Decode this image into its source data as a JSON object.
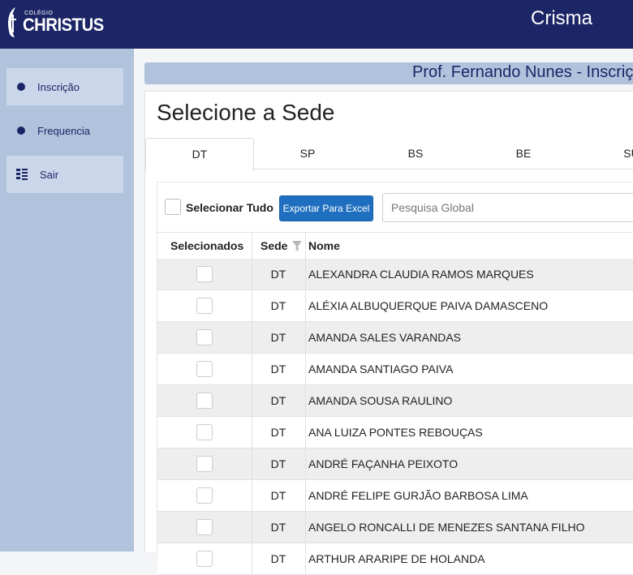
{
  "header": {
    "logo_small": "COLÉGIO",
    "logo_big": "CHRISTUS",
    "app_title": "Crisma"
  },
  "sidebar": {
    "items": [
      {
        "label": "Inscrição",
        "icon": "dot-icon"
      },
      {
        "label": "Frequencia",
        "icon": "dot-icon"
      },
      {
        "label": "Sair",
        "icon": "list-icon"
      }
    ]
  },
  "main": {
    "prof_banner": "Prof. Fernando Nunes - Inscriçã",
    "card_title": "Selecione a Sede",
    "tabs": [
      "DT",
      "SP",
      "BS",
      "BE",
      "SU"
    ],
    "active_tab": "DT",
    "select_all_label": "Selecionar Tudo",
    "export_button": "Exportar Para Excel",
    "search_placeholder": "Pesquisa Global",
    "columns": {
      "selected": "Selecionados",
      "sede": "Sede",
      "nome": "Nome"
    },
    "rows": [
      {
        "sede": "DT",
        "nome": "ALEXANDRA CLAUDIA RAMOS MARQUES"
      },
      {
        "sede": "DT",
        "nome": "ALÉXIA ALBUQUERQUE PAIVA DAMASCENO"
      },
      {
        "sede": "DT",
        "nome": "AMANDA SALES VARANDAS"
      },
      {
        "sede": "DT",
        "nome": "AMANDA SANTIAGO PAIVA"
      },
      {
        "sede": "DT",
        "nome": "AMANDA SOUSA RAULINO"
      },
      {
        "sede": "DT",
        "nome": "ANA LUIZA PONTES REBOUÇAS"
      },
      {
        "sede": "DT",
        "nome": "ANDRÉ FAÇANHA PEIXOTO"
      },
      {
        "sede": "DT",
        "nome": "ANDRÉ FELIPE GURJÃO BARBOSA LIMA"
      },
      {
        "sede": "DT",
        "nome": "ANGELO RONCALLI DE MENEZES SANTANA FILHO"
      },
      {
        "sede": "DT",
        "nome": "ARTHUR ARARIPE DE HOLANDA"
      }
    ]
  },
  "colors": {
    "navy": "#1c2566",
    "sidebar": "#b0c2dc",
    "button_blue": "#1f6fc0"
  }
}
